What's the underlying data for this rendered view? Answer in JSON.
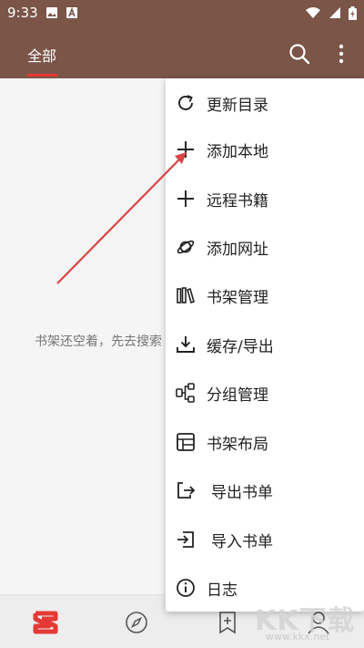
{
  "status_bar": {
    "time": "9:33",
    "icons": [
      "image-icon",
      "a-icon",
      "wifi-icon",
      "signal-icon",
      "battery-icon"
    ]
  },
  "app_bar": {
    "tab_label": "全部",
    "accent_color": "#7a5548",
    "indicator_color": "#e53935",
    "icons": [
      "search-icon",
      "more-vert-icon"
    ]
  },
  "content": {
    "empty_message": "书架还空着，先去搜索"
  },
  "menu": {
    "items": [
      {
        "label": "更新目录",
        "icon": "refresh-icon"
      },
      {
        "label": "添加本地",
        "icon": "plus-icon"
      },
      {
        "label": "远程书籍",
        "icon": "plus-icon"
      },
      {
        "label": "添加网址",
        "icon": "planet-icon"
      },
      {
        "label": "书架管理",
        "icon": "bookshelf-icon"
      },
      {
        "label": "缓存/导出",
        "icon": "download-icon"
      },
      {
        "label": "分组管理",
        "icon": "group-icon"
      },
      {
        "label": "书架布局",
        "icon": "layout-icon"
      },
      {
        "label": "导出书单",
        "icon": "export-icon"
      },
      {
        "label": "导入书单",
        "icon": "import-icon"
      },
      {
        "label": "日志",
        "icon": "info-icon"
      }
    ]
  },
  "bottom_nav": {
    "items": [
      "bookshelf-nav-icon",
      "explore-icon",
      "bookmark-add-icon",
      "profile-icon"
    ],
    "active_color": "#e53935"
  },
  "watermark": {
    "text": "KK下载",
    "url": "www.kkx.net"
  }
}
